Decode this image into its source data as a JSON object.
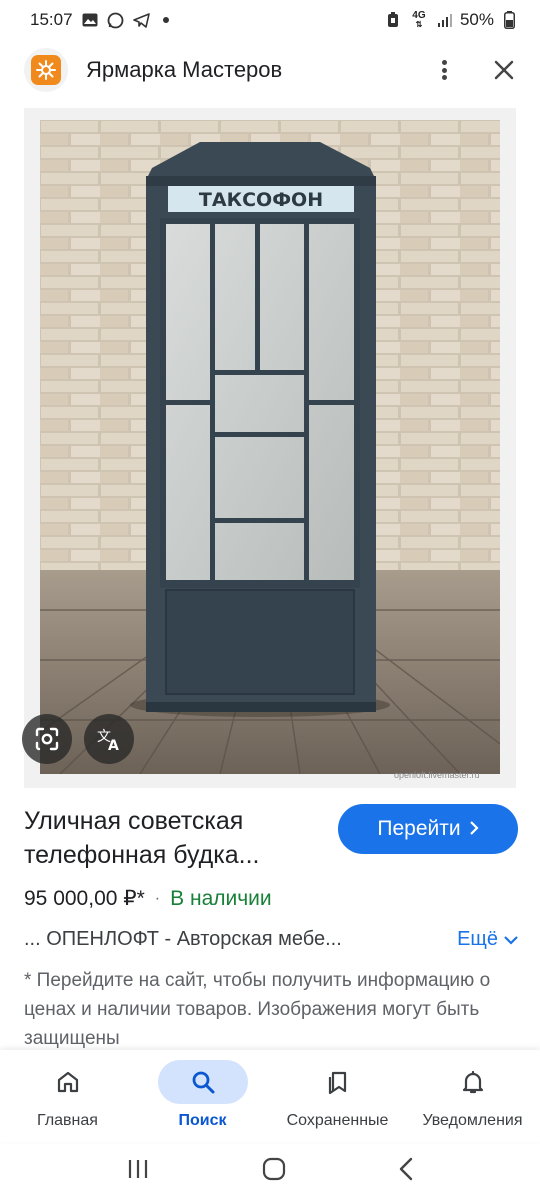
{
  "status_bar": {
    "time": "15:07",
    "battery": "50%",
    "network": "4G",
    "left_icons": [
      "gallery-icon",
      "whatsapp-icon",
      "telegram-icon",
      "dot-icon"
    ],
    "right_icons": [
      "battery-saver-icon",
      "4g-icon",
      "signal-icon",
      "battery-icon"
    ]
  },
  "header": {
    "site_name": "Ярмарка Мастеров",
    "logo_icon": "livemaster-logo-icon",
    "menu_icon": "more-vert-icon",
    "close_icon": "close-icon"
  },
  "image": {
    "sign_text": "ТАКСОФОН",
    "watermark": "openloft.livemaster.ru",
    "lens_icon": "google-lens-icon",
    "translate_icon": "translate-icon"
  },
  "result": {
    "title": "Уличная советская телефонная будка...",
    "go_button": "Перейти",
    "price": "95 000,00 ₽*",
    "availability": "В наличии",
    "source": "... ОПЕНЛОФТ - Авторская мебе...",
    "more_link": "Ещё",
    "disclaimer": "* Перейдите на сайт, чтобы получить информацию о ценах и наличии товаров. Изображения могут быть защищены"
  },
  "bottom_nav": {
    "items": [
      {
        "label": "Главная",
        "icon": "home-icon",
        "active": false
      },
      {
        "label": "Поиск",
        "icon": "search-icon",
        "active": true
      },
      {
        "label": "Сохраненные",
        "icon": "bookmarks-icon",
        "active": false
      },
      {
        "label": "Уведомления",
        "icon": "bell-icon",
        "active": false
      }
    ]
  },
  "colors": {
    "accent": "#1a73e8",
    "in_stock": "#188038",
    "active_nav_bg": "#d3e3fd",
    "booth": "#3a4954"
  }
}
